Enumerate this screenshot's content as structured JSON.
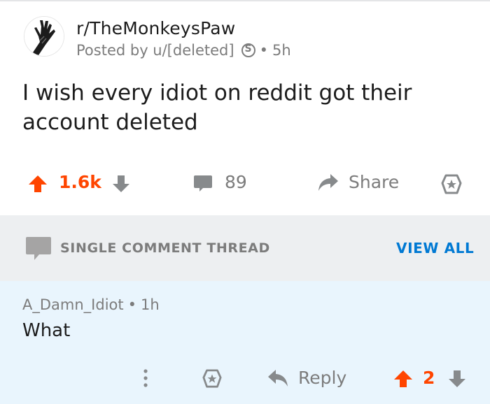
{
  "post": {
    "subreddit": "r/TheMonkeysPaw",
    "posted_by": "Posted by u/[deleted]",
    "badge_glyph": "S",
    "separator": "•",
    "age": "5h",
    "title": "I wish every idiot on reddit got their account deleted",
    "score": "1.6k",
    "comment_count": "89",
    "share_label": "Share"
  },
  "thread": {
    "label": "SINGLE COMMENT THREAD",
    "view_all": "VIEW ALL"
  },
  "comment": {
    "author": "A_Damn_Idiot",
    "separator": "•",
    "age": "1h",
    "body": "What",
    "reply_label": "Reply",
    "score": "2"
  },
  "colors": {
    "upvote": "#ff4500",
    "link": "#0079d3",
    "muted": "#7c7c7c",
    "thread_bg": "#edeff1",
    "comment_bg": "#e9f5fd"
  },
  "icons": {
    "avatar": "monkey-paw-icon",
    "upvote": "arrow-up-icon",
    "downvote": "arrow-down-icon",
    "comment": "speech-bubble-icon",
    "share": "share-arrow-icon",
    "award": "award-star-icon",
    "more": "vertical-dots-icon",
    "reply": "reply-arrow-icon"
  }
}
